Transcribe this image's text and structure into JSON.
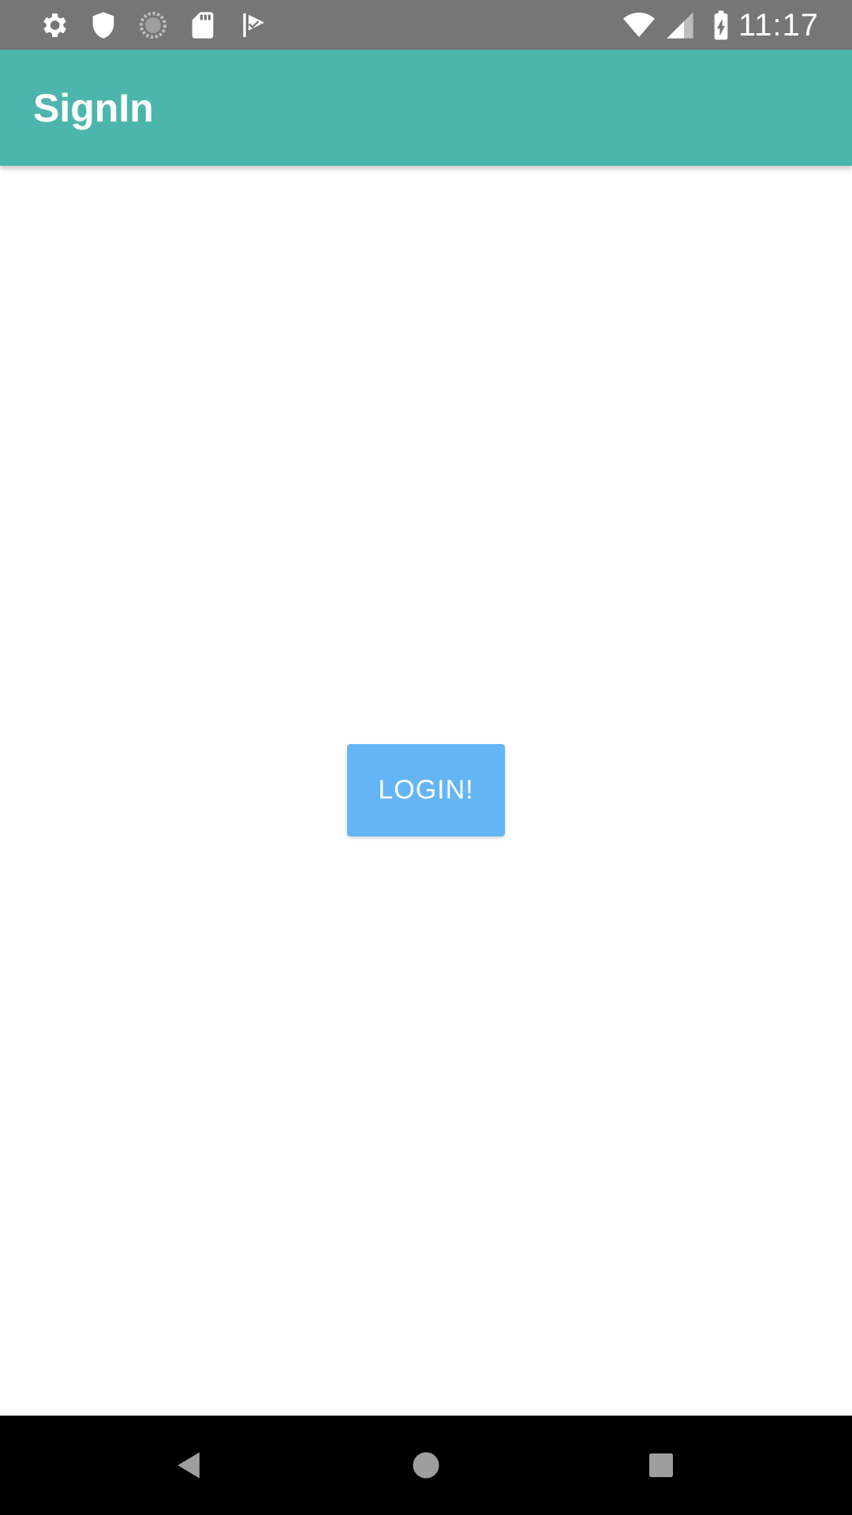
{
  "status_bar": {
    "time": "11:17",
    "left_icons": [
      "gear-icon",
      "shield-icon",
      "sync-circle-icon",
      "sd-card-icon",
      "check-flag-icon"
    ],
    "right_icons": [
      "wifi-icon",
      "cell-signal-icon",
      "battery-charging-icon"
    ],
    "background": "#767676"
  },
  "app_bar": {
    "title": "SignIn",
    "background": "#4db6ac"
  },
  "main": {
    "login_button_label": "LOGIN!",
    "login_button_color": "#64b5f6"
  },
  "nav_bar": {
    "buttons": [
      "back-icon",
      "home-icon",
      "recents-icon"
    ],
    "background": "#000000"
  }
}
